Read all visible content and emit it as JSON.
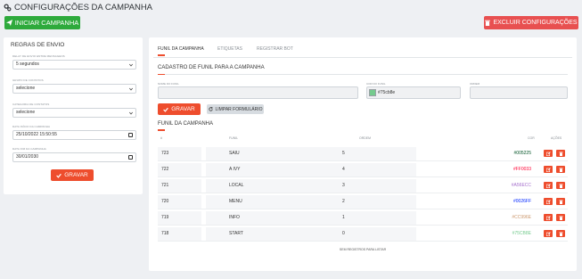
{
  "header": {
    "title": "CONFIGURAÇÕES DA CAMPANHA",
    "start_label": "INICIAR CAMPANHA",
    "delete_label": "EXCLUIR CONFIGURAÇÕES"
  },
  "left": {
    "heading": "REGRAS DE ENVIO",
    "delay_label": "DELAY DE ENVIO ENTRE MENSAGENS",
    "delay_value": "5 segundos",
    "group_label": "GRUPO DE CONTATOS",
    "group_value": "selecione",
    "category_label": "CATEGORIA DE CONTATOS",
    "category_value": "selecione",
    "start_date_label": "DATA INÍCIO DA CAMPANHA",
    "start_date_value": "25/10/2022 15:50:55",
    "end_date_label": "DATA FIM DA CAMPANHA",
    "end_date_value": "30/01/2030",
    "save_label": "GRAVAR"
  },
  "main": {
    "tabs": [
      {
        "label": "FUNIL DA CAMPANHA"
      },
      {
        "label": "ETIQUETAS"
      },
      {
        "label": "REGISTRAR BOT"
      }
    ],
    "form_title": "CADASTRO DE FUNIL PARA A CAMPANHA",
    "fields": {
      "name_label": "NOME DO FUNIL",
      "color_label": "COR DO FUNIL",
      "color_value": "#75cb8e",
      "order_label": "ORDEM"
    },
    "save_label": "GRAVAR",
    "clear_label": "LIMPAR FORMULÁRIO",
    "table_title": "FUNIL DA CAMPANHA",
    "columns": {
      "id": "#",
      "funil": "FUNIL",
      "ordem": "ORDEM",
      "cor": "COR",
      "acoes": "AÇÕES"
    },
    "rows": [
      {
        "id": "723",
        "funil": "SAIU",
        "ordem": "5",
        "cor": "#005225",
        "color": "#005225"
      },
      {
        "id": "722",
        "funil": "A IVY",
        "ordem": "4",
        "cor": "#FF0033",
        "color": "#FF0033"
      },
      {
        "id": "721",
        "funil": "LOCAL",
        "ordem": "3",
        "cor": "#A56ECC",
        "color": "#A56ECC"
      },
      {
        "id": "720",
        "funil": "MENU",
        "ordem": "2",
        "cor": "#0026FF",
        "color": "#0026FF"
      },
      {
        "id": "719",
        "funil": "INFO",
        "ordem": "1",
        "cor": "#CC996E",
        "color": "#CC996E"
      },
      {
        "id": "718",
        "funil": "START",
        "ordem": "0",
        "cor": "#75CB8E",
        "color": "#75CB8E"
      }
    ],
    "empty_text": "SEM REGISTROS PARA LISTAR"
  }
}
